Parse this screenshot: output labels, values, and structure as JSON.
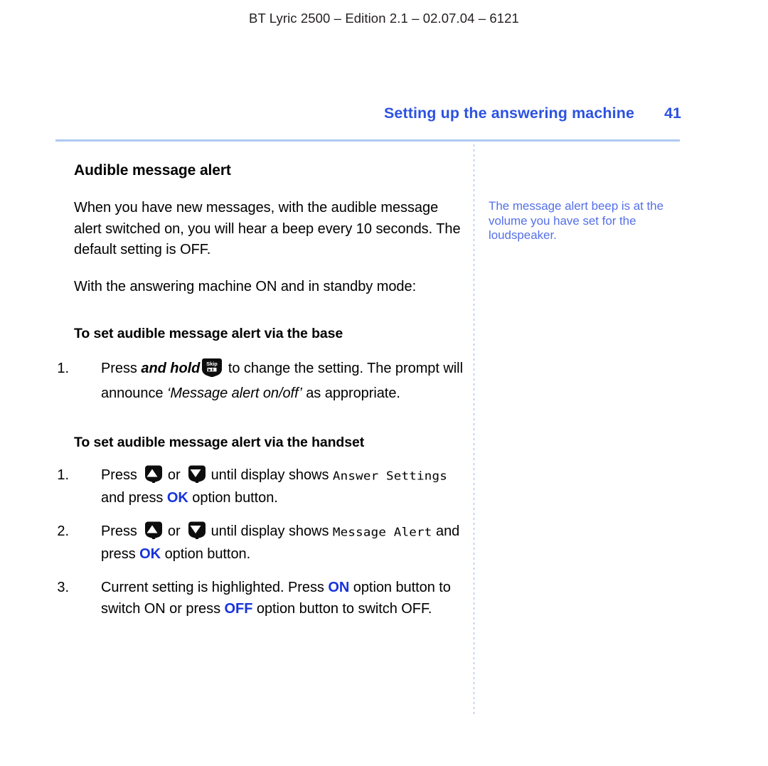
{
  "header": {
    "running_head": "BT Lyric 2500 – Edition 2.1 – 02.07.04 – 6121",
    "chapter_title": "Setting up the answering machine",
    "page_number": "41"
  },
  "colors": {
    "accent_blue": "#2c52e0",
    "key_blue": "#1633db",
    "note_blue": "#5570e8",
    "rule_blue": "#aec9f2"
  },
  "main": {
    "section_heading": "Audible message alert",
    "intro_paragraph": "When you have new messages, with the audible message alert switched on, you will hear a beep every 10 seconds. The default setting is OFF.",
    "standby_paragraph": "With the answering machine ON and in standby mode:",
    "base_heading": "To set audible message alert via the base",
    "handset_heading": "To set audible message alert via the handset",
    "base_steps": [
      {
        "number": "1.",
        "part1": "Press ",
        "emphasis": "and hold",
        "icon": "skip-key-icon",
        "icon_label": "Skip",
        "part2": " to change the setting. The prompt will announce ",
        "quote": "‘Message alert on/off’",
        "part3": " as appropriate."
      }
    ],
    "handset_steps": [
      {
        "number": "1.",
        "part1": "Press ",
        "up_icon": "up-arrow-key-icon",
        "or": " or ",
        "down_icon": "down-arrow-key-icon",
        "part2": " until display shows ",
        "display_text": "Answer Settings",
        "part3": " and press ",
        "key": "OK",
        "part4": " option button."
      },
      {
        "number": "2.",
        "part1": "Press ",
        "up_icon": "up-arrow-key-icon",
        "or": " or ",
        "down_icon": "down-arrow-key-icon",
        "part2": " until display shows ",
        "display_text": "Message Alert",
        "part3": " and press ",
        "key": "OK",
        "part4": " option button."
      },
      {
        "number": "3.",
        "part1": "Current setting is highlighted. Press ",
        "key_on": "ON",
        "part2": " option button to switch ON or press ",
        "key_off": "OFF",
        "part3": " option button to switch OFF."
      }
    ]
  },
  "sidebar": {
    "note": "The message alert beep is at the volume you have set for the loudspeaker."
  }
}
